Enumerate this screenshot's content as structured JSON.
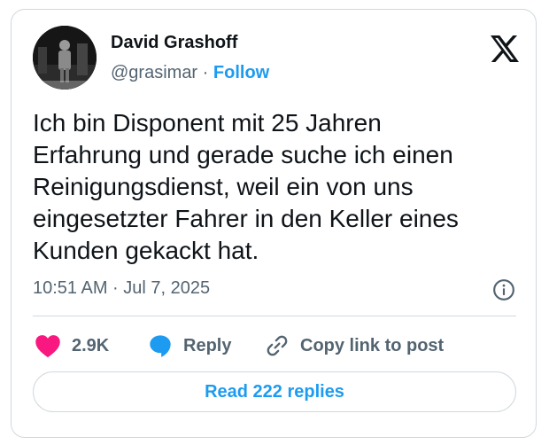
{
  "author": {
    "name": "David Grashoff",
    "handle": "@grasimar",
    "separator": "·",
    "follow_label": "Follow"
  },
  "tweet": {
    "text": "Ich bin Disponent mit 25 Jahren\nErfahrung und gerade suche ich einen\nReinigungsdienst, weil ein von uns\neingesetzter Fahrer in den Keller eines\nKunden gekackt hat.",
    "timestamp": "10:51 AM · Jul 7, 2025"
  },
  "actions": {
    "likes_count": "2.9K",
    "reply_label": "Reply",
    "copy_label": "Copy link to post"
  },
  "read_replies_label": "Read 222 replies",
  "icons": {
    "logo": "x-logo-icon",
    "info": "info-icon",
    "like": "heart-icon",
    "reply": "speech-bubble-icon",
    "copy": "link-icon"
  },
  "colors": {
    "accent": "#1d9bf0",
    "heart": "#f91880",
    "text": "#0f1419",
    "secondary": "#536471",
    "border": "#cfd9de"
  }
}
